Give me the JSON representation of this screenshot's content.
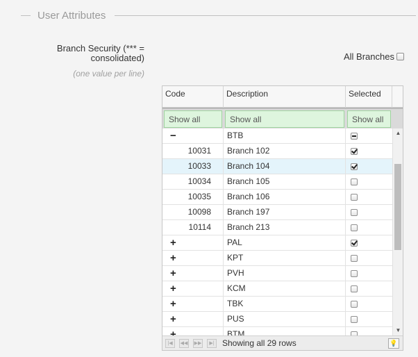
{
  "section": {
    "title": "User Attributes"
  },
  "field": {
    "label": "Branch Security (*** = consolidated)",
    "hint": "(one value per line)"
  },
  "all_branches": {
    "label": "All Branches",
    "checked": false
  },
  "grid": {
    "columns": [
      "Code",
      "Description",
      "Selected"
    ],
    "filters": [
      "Show all",
      "Show all",
      "Show all"
    ],
    "rows": [
      {
        "toggle": "−",
        "code": "",
        "description": "BTB",
        "selected": "partial"
      },
      {
        "toggle": "",
        "code": "10031",
        "description": "Branch 102",
        "selected": "checked"
      },
      {
        "toggle": "",
        "code": "10033",
        "description": "Branch 104",
        "selected": "checked",
        "highlight": true
      },
      {
        "toggle": "",
        "code": "10034",
        "description": "Branch 105",
        "selected": "unchecked"
      },
      {
        "toggle": "",
        "code": "10035",
        "description": "Branch 106",
        "selected": "unchecked"
      },
      {
        "toggle": "",
        "code": "10098",
        "description": "Branch 197",
        "selected": "unchecked"
      },
      {
        "toggle": "",
        "code": "10114",
        "description": "Branch 213",
        "selected": "unchecked"
      },
      {
        "toggle": "+",
        "code": "",
        "description": "PAL",
        "selected": "checked"
      },
      {
        "toggle": "+",
        "code": "",
        "description": "KPT",
        "selected": "unchecked"
      },
      {
        "toggle": "+",
        "code": "",
        "description": "PVH",
        "selected": "unchecked"
      },
      {
        "toggle": "+",
        "code": "",
        "description": "KCM",
        "selected": "unchecked"
      },
      {
        "toggle": "+",
        "code": "",
        "description": "TBK",
        "selected": "unchecked"
      },
      {
        "toggle": "+",
        "code": "",
        "description": "PUS",
        "selected": "unchecked"
      },
      {
        "toggle": "+",
        "code": "",
        "description": "BTM",
        "selected": "unchecked"
      }
    ],
    "footer_text": "Showing all 29 rows",
    "pager_icons": [
      "first-page-icon",
      "prev-page-icon",
      "next-page-icon",
      "last-page-icon"
    ],
    "scroll_position": 0.17,
    "highlight_color": "#e4f4fb",
    "filter_color": "#def5de"
  }
}
